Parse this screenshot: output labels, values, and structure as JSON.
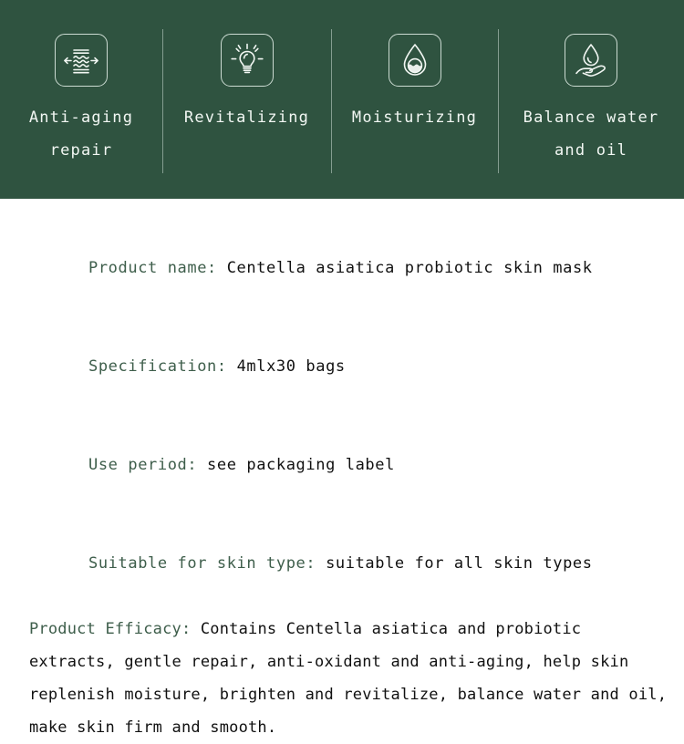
{
  "theme": {
    "band_bg": "#2f5340",
    "band_text": "#f2f7f3",
    "page_bg": "#ffffff",
    "label_color": "#3e5e4b",
    "value_color": "#111111",
    "divider_color": "#e2eee7"
  },
  "features": [
    {
      "icon": "anti-aging-wave-icon",
      "label": "Anti-aging\nrepair"
    },
    {
      "icon": "revitalizing-lightbulb-icon",
      "label": "Revitalizing"
    },
    {
      "icon": "moisturizing-droplet-icon",
      "label": "Moisturizing"
    },
    {
      "icon": "balance-water-oil-hand-droplet-icon",
      "label": "Balance water\nand oil"
    }
  ],
  "info": {
    "rows": [
      {
        "label": "Product name:",
        "value": "Centella asiatica probiotic skin mask"
      },
      {
        "label": "Specification:",
        "value": "4mlx30 bags"
      },
      {
        "label": "Use period:",
        "value": "see packaging label"
      },
      {
        "label": "Suitable for skin type:",
        "value": "suitable for all skin types"
      }
    ],
    "efficacy": {
      "label": "Product Efficacy:",
      "value": "Contains Centella asiatica and probiotic extracts, gentle repair, anti-oxidant and anti-aging, help skin replenish moisture, brighten and revitalize, balance water and oil, make skin firm and smooth."
    }
  }
}
